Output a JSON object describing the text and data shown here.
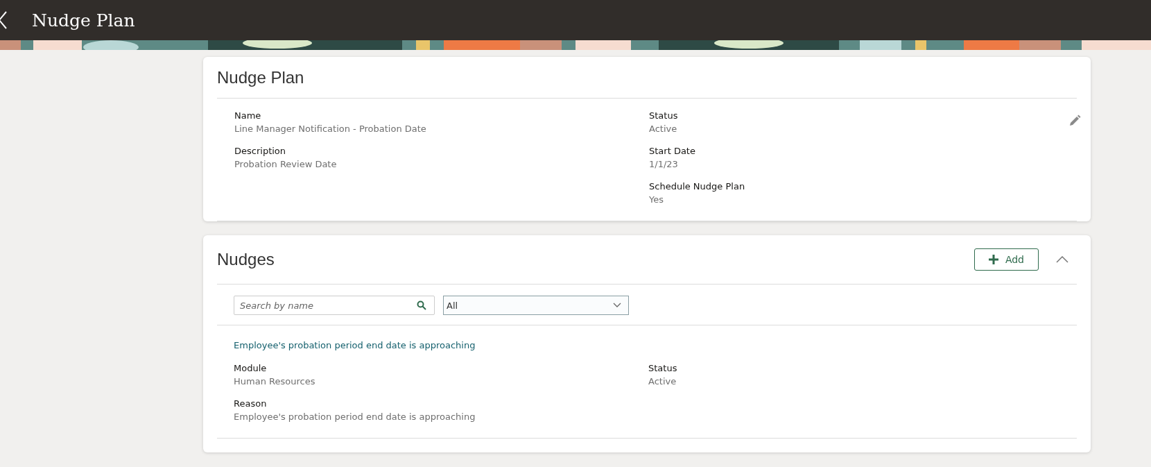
{
  "header": {
    "title": "Nudge Plan"
  },
  "plan": {
    "title": "Nudge Plan",
    "columns": [
      [
        {
          "label": "Name",
          "value": "Line Manager Notification - Probation Date"
        },
        {
          "label": "Description",
          "value": "Probation Review Date"
        }
      ],
      [
        {
          "label": "Status",
          "value": "Active"
        },
        {
          "label": "Start Date",
          "value": "1/1/23"
        },
        {
          "label": "Schedule Nudge Plan",
          "value": "Yes"
        }
      ]
    ]
  },
  "nudges": {
    "title": "Nudges",
    "add_button": "Add",
    "expanded": true,
    "search": {
      "placeholder": "Search by name"
    },
    "filter": {
      "value": "All"
    },
    "items": [
      {
        "title": "Employee's probation period end date is approaching",
        "columns": [
          [
            {
              "label": "Module",
              "value": "Human Resources"
            },
            {
              "label": "Reason",
              "value": "Employee's probation period end date is approaching"
            }
          ],
          [
            {
              "label": "Status",
              "value": "Active"
            }
          ]
        ]
      }
    ]
  }
}
